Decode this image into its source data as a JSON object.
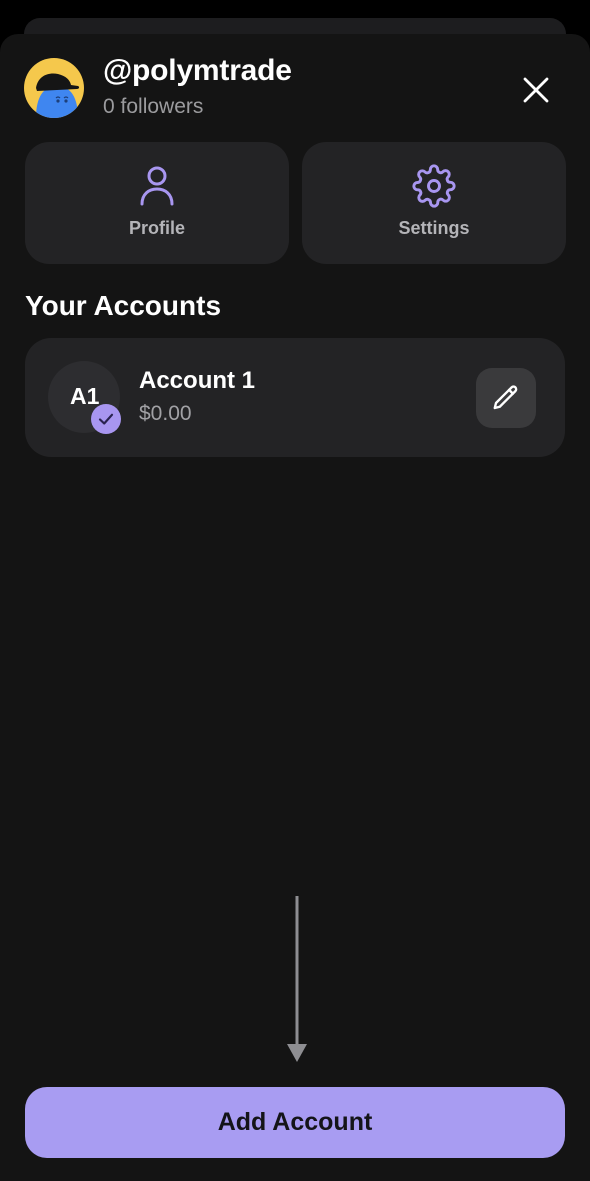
{
  "profile_header": {
    "username": "@polymtrade",
    "followers_text": "0 followers",
    "avatar_icon": "cap-character-avatar-icon"
  },
  "quick_actions": [
    {
      "label": "Profile",
      "icon": "person-icon"
    },
    {
      "label": "Settings",
      "icon": "gear-icon"
    }
  ],
  "accounts_section": {
    "title": "Your Accounts",
    "accounts": [
      {
        "initials": "A1",
        "name": "Account 1",
        "balance": "$0.00",
        "selected": true
      }
    ]
  },
  "footer": {
    "add_account_label": "Add Account"
  },
  "colors": {
    "accent": "#a896f0",
    "button_fill": "#a89cf2",
    "sheet_background": "#141414",
    "card_background": "#232325"
  }
}
